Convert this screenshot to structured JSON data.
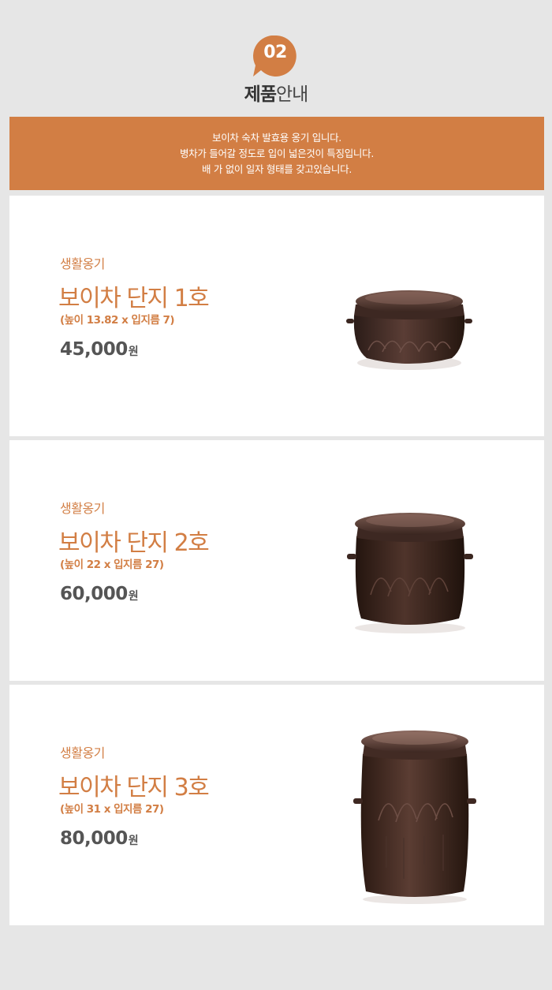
{
  "section": {
    "number": "02",
    "title_bold": "제품",
    "title_light": "안내"
  },
  "banner": {
    "lines": [
      "보이차 숙차 발효용 옹기 입니다.",
      "병차가 들어갈 정도로 입이 넓은것이 특징입니다.",
      "배 가 없이 일자 형태를 갖고있습니다."
    ]
  },
  "colors": {
    "accent": "#d27e44",
    "background": "#e6e6e6",
    "card": "#ffffff",
    "price_text": "#555555"
  },
  "products": [
    {
      "category": "생활옹기",
      "name": "보이차 단지 1호",
      "spec": "(높이 13.82 x 입지름 7)",
      "price": "45,000",
      "currency": "원",
      "image_icon": "onggi-jar-image"
    },
    {
      "category": "생활옹기",
      "name": "보이차 단지 2호",
      "spec": "(높이 22 x 입지름 27)",
      "price": "60,000",
      "currency": "원",
      "image_icon": "onggi-jar-image"
    },
    {
      "category": "생활옹기",
      "name": "보이차 단지 3호",
      "spec": "(높이 31 x 입지름 27)",
      "price": "80,000",
      "currency": "원",
      "image_icon": "onggi-jar-image"
    }
  ]
}
